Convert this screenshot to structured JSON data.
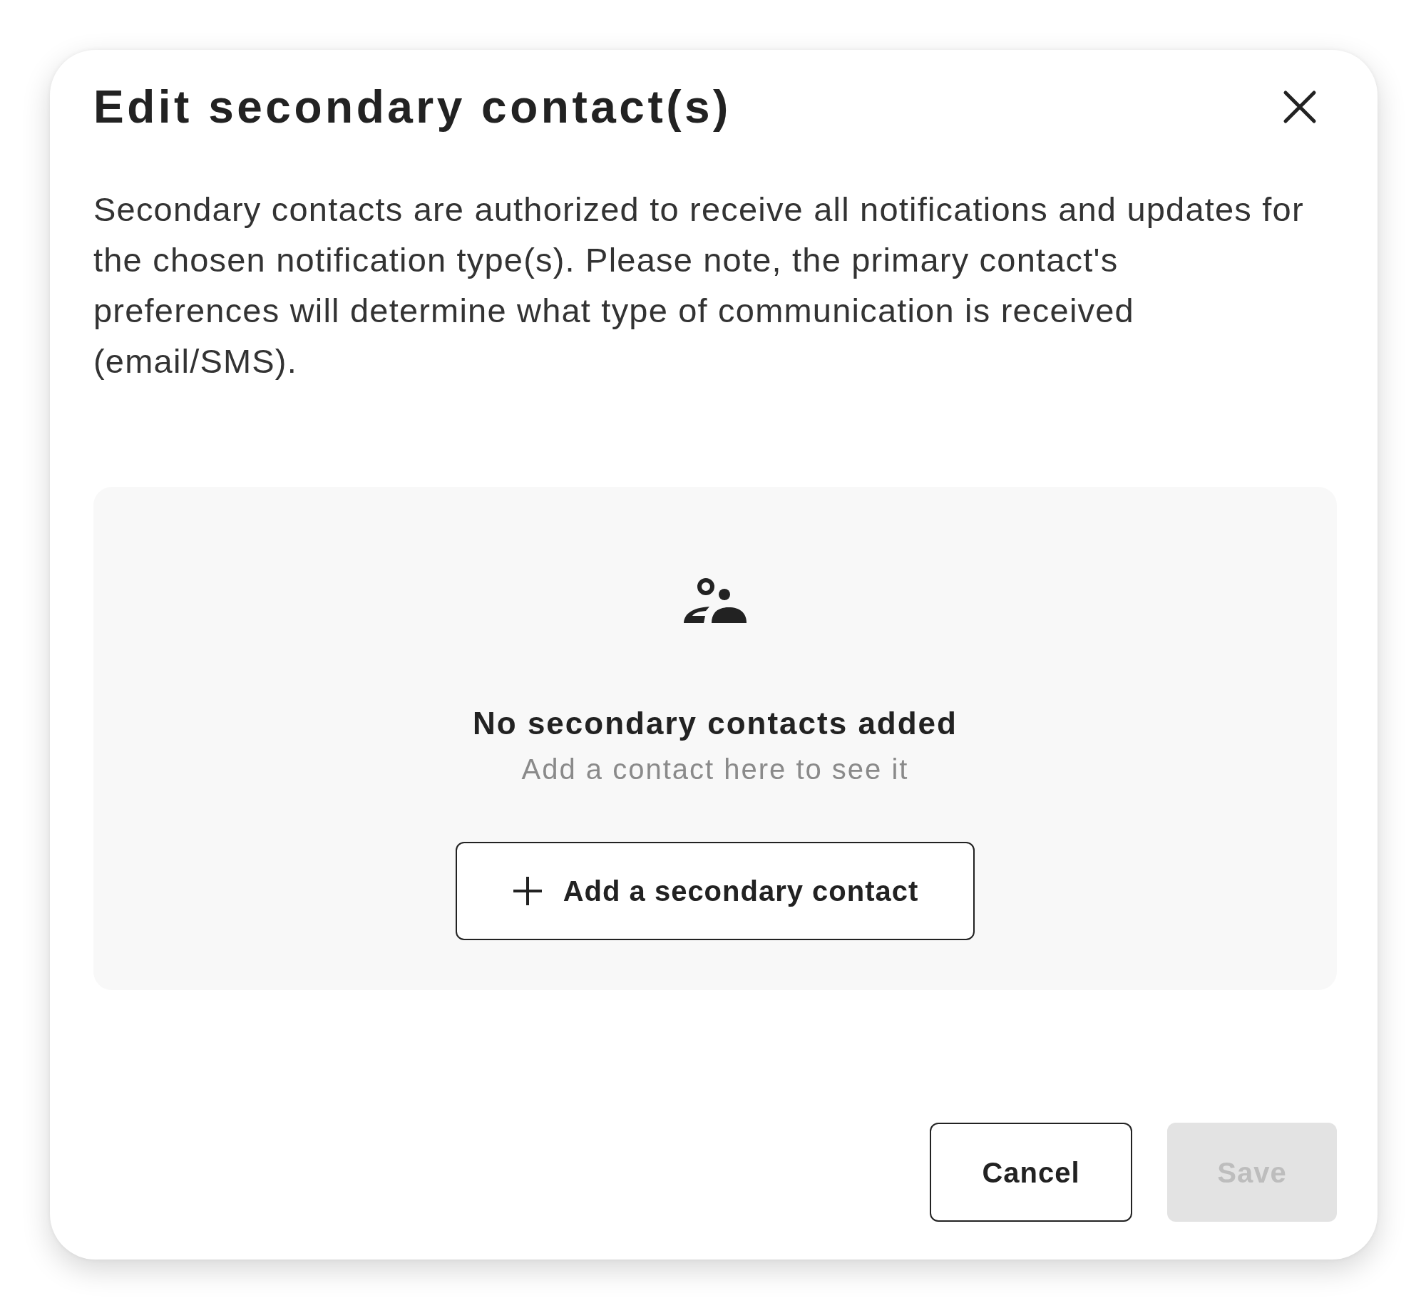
{
  "dialog": {
    "title": "Edit secondary contact(s)",
    "description": "Secondary contacts are authorized to receive all notifications and updates for the chosen notification type(s). Please note, the primary contact's preferences will determine what type of communication is received (email/SMS).",
    "empty_state": {
      "heading": "No secondary contacts added",
      "subtext": "Add a contact here to see it",
      "add_button": "Add a secondary contact"
    },
    "buttons": [
      {
        "label": "Cancel",
        "kind": "secondary",
        "disabled": false
      },
      {
        "label": "Save",
        "kind": "primary",
        "disabled": true
      }
    ]
  }
}
